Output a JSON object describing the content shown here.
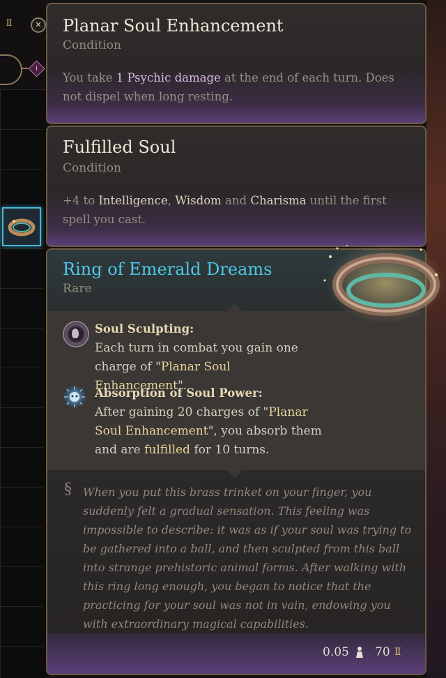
{
  "conditions": [
    {
      "title": "Planar Soul Enhancement",
      "type": "Condition",
      "desc_pre": "You take ",
      "desc_hl": "1 Psychic damage",
      "desc_post": " at the end of each turn. Does not dispel when long resting."
    },
    {
      "title": "Fulfilled Soul",
      "type": "Condition",
      "desc_a": "+4 to ",
      "stat1": "Intelligence",
      "sep1": ", ",
      "stat2": "Wisdom",
      "sep2": " and ",
      "stat3": "Charisma",
      "desc_b": " until the first spell you cast."
    }
  ],
  "item": {
    "name": "Ring of Emerald Dreams",
    "rarity": "Rare",
    "abilities": [
      {
        "name": "Soul Sculpting:",
        "text_a": "Each turn in combat you gain one charge of \"",
        "text_hl": "Planar Soul Enhancement",
        "text_b": "\"."
      },
      {
        "name": "Absorption of Soul Power:",
        "text_a": "After gaining 20 charges of \"",
        "text_hl": "Planar Soul Enhancement",
        "text_b": "\", you absorb them and are ",
        "text_hl2": "fulfilled",
        "text_c": " for 10 turns."
      }
    ],
    "lore": "When you put this brass trinket on your finger, you suddenly felt a gradual sensation. This feeling was impossible to describe: it was as if your soul was trying to be gathered into a ball, and then sculpted from this ball into strange prehistoric animal forms. After walking with this ring long enough, you began to notice that the practicing for your soul was not in vain, endowing you with extraordinary magical capabilities.",
    "weight": "0.05",
    "price": "70"
  },
  "icons": {
    "close": "close-icon",
    "info": "info-icon",
    "gold": "gold-coin-icon",
    "weight": "weight-icon",
    "soul_sculpting": "soul-mask-icon",
    "absorption": "soul-burst-icon",
    "lore": "lore-scroll-icon"
  },
  "colors": {
    "rarity_rare": "#4fc6e8",
    "panel_accent": "#5b3f78",
    "highlight_gold": "#e8d49a"
  }
}
